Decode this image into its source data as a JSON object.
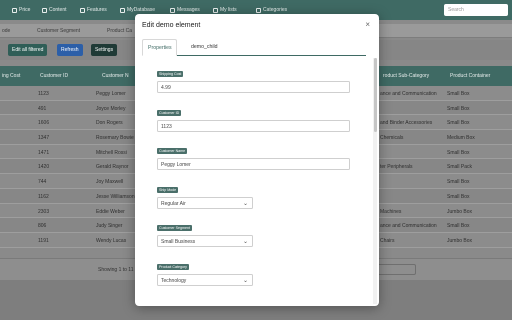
{
  "nav": {
    "items": [
      {
        "label": "Price",
        "icon": "tag-icon"
      },
      {
        "label": "Content",
        "icon": "document-icon"
      },
      {
        "label": "Features",
        "icon": "star-icon"
      },
      {
        "label": "MyDatabase",
        "icon": "database-icon"
      },
      {
        "label": "Messages",
        "icon": "message-icon"
      },
      {
        "label": "My lists",
        "icon": "list-icon"
      },
      {
        "label": "Categories",
        "icon": "grid-icon"
      }
    ],
    "search_placeholder": "Search"
  },
  "filters": [
    "ode",
    "Customer Segment",
    "Product Ca"
  ],
  "actions": [
    "Edit all filtered",
    "Refresh",
    "Settings"
  ],
  "grid": {
    "headers": [
      "ing Cost",
      "Customer ID",
      "Customer N",
      "roduct Sub-Category",
      "Product Container"
    ],
    "rows": [
      [
        "1123",
        "Peggy Lomer",
        "ance and Communication",
        "Small Box"
      ],
      [
        "491",
        "Joyce Morley",
        "",
        "Small Box"
      ],
      [
        "1606",
        "Don Rogers",
        "and Binder Accessories",
        "Small Box"
      ],
      [
        "1347",
        "Rosemary Bowie",
        "Chemicals",
        "Medium Box"
      ],
      [
        "1471",
        "Mitchell Rossi",
        "",
        "Small Box"
      ],
      [
        "1420",
        "Gerald Raynor",
        "ter Peripherals",
        "Small Pack"
      ],
      [
        "744",
        "Joy Maxwell",
        "",
        "Small Box"
      ],
      [
        "1162",
        "Jesse Williamson",
        "",
        "Small Box"
      ],
      [
        "2303",
        "Eddie Weber",
        "Machines",
        "Jumbo Box"
      ],
      [
        "806",
        "Judy Singer",
        "ance and Communication",
        "Small Box"
      ],
      [
        "1191",
        "Wendy Lucas",
        "Chairs",
        "Jumbo Box"
      ]
    ],
    "footer_text": "Showing 1 to 11"
  },
  "modal": {
    "title": "Edit demo element",
    "tabs": [
      "Properties",
      "demo_child"
    ],
    "fields": [
      {
        "label": "Shipping Cost",
        "value": "4.99",
        "type": "input"
      },
      {
        "label": "Customer ID",
        "value": "1123",
        "type": "input"
      },
      {
        "label": "Customer Name",
        "value": "Peggy Lomer",
        "type": "input"
      },
      {
        "label": "Ship Mode",
        "value": "Regular Air",
        "type": "select"
      },
      {
        "label": "Customer Segment",
        "value": "Small Business",
        "type": "select"
      },
      {
        "label": "Product Category",
        "value": "Technology",
        "type": "select"
      }
    ]
  }
}
